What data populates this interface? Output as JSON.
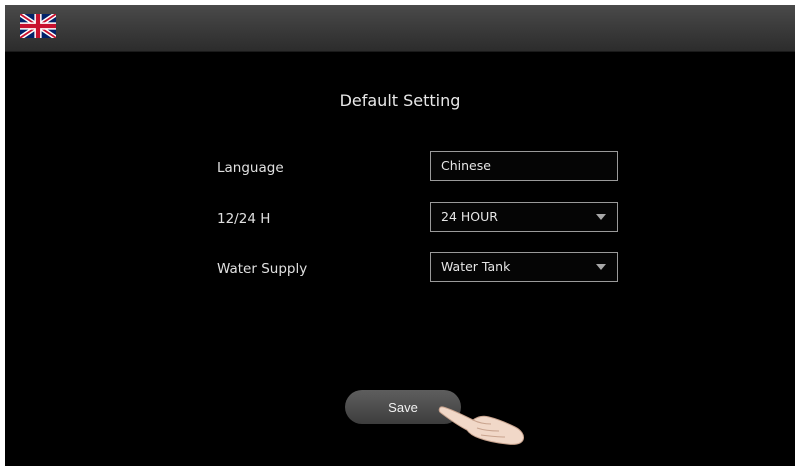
{
  "header": {
    "flag_icon": "uk-flag-icon"
  },
  "page": {
    "title": "Default Setting"
  },
  "settings": [
    {
      "label": "Language",
      "value": "Chinese",
      "type": "text"
    },
    {
      "label": "12/24 H",
      "value": "24 HOUR",
      "type": "select"
    },
    {
      "label": "Water Supply",
      "value": "Water Tank",
      "type": "select"
    }
  ],
  "actions": {
    "save_label": "Save"
  },
  "colors": {
    "background": "#000000",
    "topbar": "#3a3a3a",
    "field_border": "#9a9a9a",
    "button": "#4a4a4a",
    "text": "#e6e6e6"
  },
  "icons": {
    "dropdown": "chevron-down-icon",
    "pointer": "pointing-hand-icon"
  }
}
